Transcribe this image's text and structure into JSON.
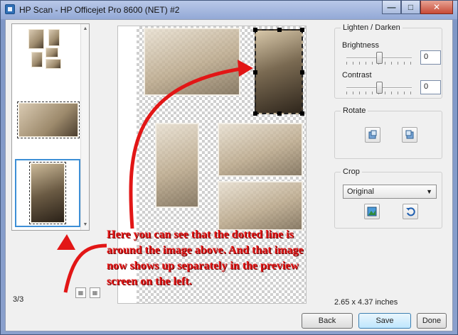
{
  "window": {
    "title": "HP Scan - HP Officejet Pro 8600 (NET) #2",
    "min_label": "—",
    "max_label": "□",
    "close_label": "✕"
  },
  "left": {
    "page_count": "3/3",
    "scroll_up": "▲",
    "scroll_down": "▼"
  },
  "lighten_darken": {
    "label": "Lighten / Darken",
    "brightness_label": "Brightness",
    "brightness_value": "0",
    "contrast_label": "Contrast",
    "contrast_value": "0"
  },
  "rotate": {
    "label": "Rotate"
  },
  "crop": {
    "label": "Crop",
    "selected": "Original"
  },
  "scan_size": "2.65 x 4.37 inches",
  "buttons": {
    "back": "Back",
    "save": "Save",
    "done": "Done"
  },
  "annotation": "Here you can see that the dotted line is around the image above.  And that image now shows up separately in the preview screen on the left."
}
